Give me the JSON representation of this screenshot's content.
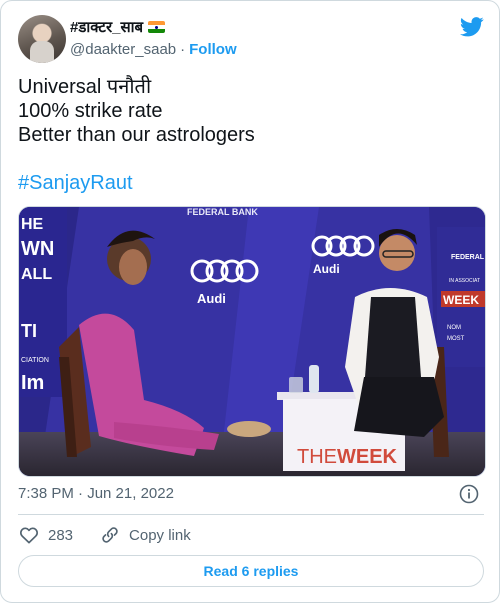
{
  "author": {
    "display_name": "#डाक्टर_साब",
    "flag_emoji": "🇮🇳",
    "handle": "@daakter_saab",
    "separator": "·",
    "follow_label": "Follow"
  },
  "tweet": {
    "lines": [
      "Universal पनौती",
      "100% strike rate",
      "Better than our astrologers"
    ],
    "hashtag": "#SanjayRaut"
  },
  "media": {
    "signage_left": [
      "HE",
      "WN",
      "ALL",
      "TI",
      "CIATION",
      "Im"
    ],
    "banner_top": "FEDERAL BANK",
    "sponsor_left": "Audi",
    "sponsor_right": "Audi",
    "side_right": [
      "FEDERAL",
      "IN ASSOCIAT",
      "WEEK",
      "NOM",
      "MOST"
    ],
    "podium_prefix": "THE",
    "podium_suffix": "WEEK"
  },
  "meta": {
    "timestamp": "7:38 PM · Jun 21, 2022"
  },
  "actions": {
    "like_count": "283",
    "copy_link_label": "Copy link"
  },
  "replies": {
    "button_label": "Read 6 replies"
  },
  "colors": {
    "accent": "#1d9bf0",
    "text": "#0f1419",
    "muted": "#536471",
    "border": "#cfd9de",
    "backdrop": "#3b34a8"
  },
  "icons": [
    "twitter-bird-icon",
    "info-icon",
    "heart-icon",
    "link-icon"
  ]
}
